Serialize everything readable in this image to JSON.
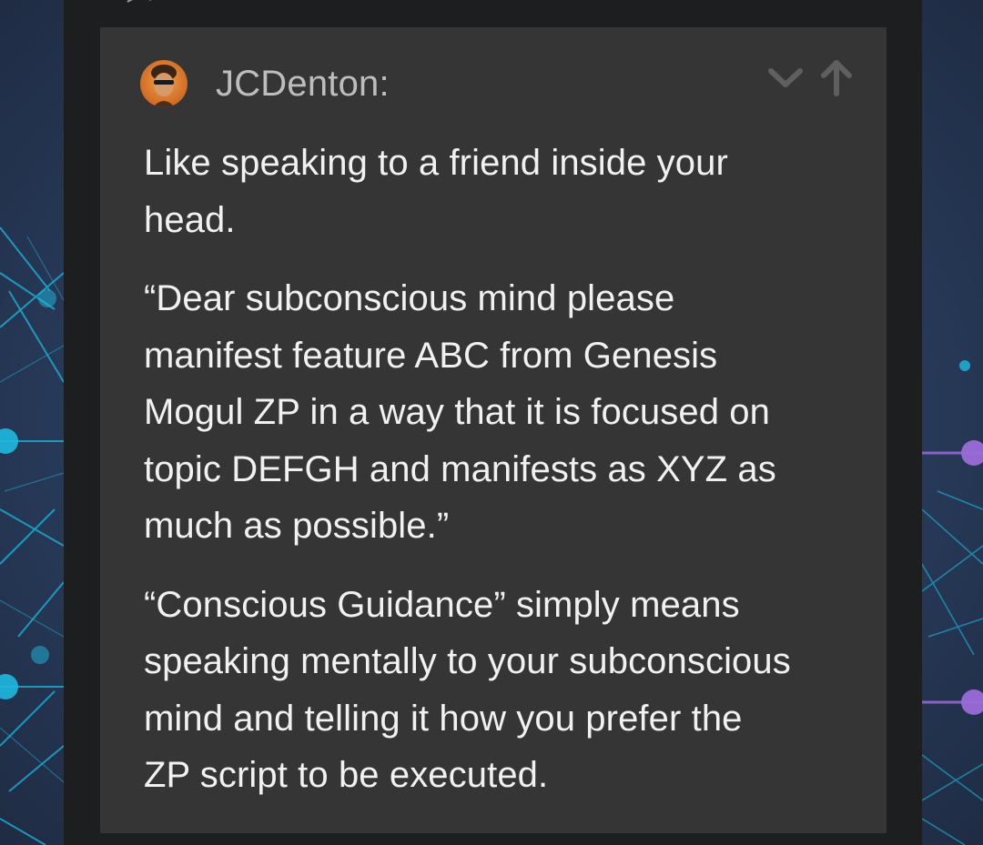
{
  "comment": {
    "author": "JCDenton:",
    "paragraphs": [
      "Like speaking to a friend inside your\nhead.",
      "“Dear subconscious mind please\nmanifest feature ABC from Genesis\nMogul ZP in a way that it is focused on\ntopic DEFGH and manifests as XYZ as\nmuch as possible.”",
      "“Conscious Guidance” simply means\nspeaking mentally to your subconscious\nmind and telling it how you prefer the\nZP script to be executed."
    ]
  },
  "icons": {
    "downvote": "chevron-down-icon",
    "upvote": "arrow-up-icon",
    "avatar": "user-avatar"
  },
  "colors": {
    "page_bg": "#2a3a55",
    "panel_bg": "#1d1e20",
    "card_bg": "#353535",
    "text": "#f1f1f1",
    "username": "#bdbdbd",
    "vote_icon": "#5f5f5f",
    "network_cyan": "#1fb8e0",
    "network_violet": "#9a6bd8"
  }
}
